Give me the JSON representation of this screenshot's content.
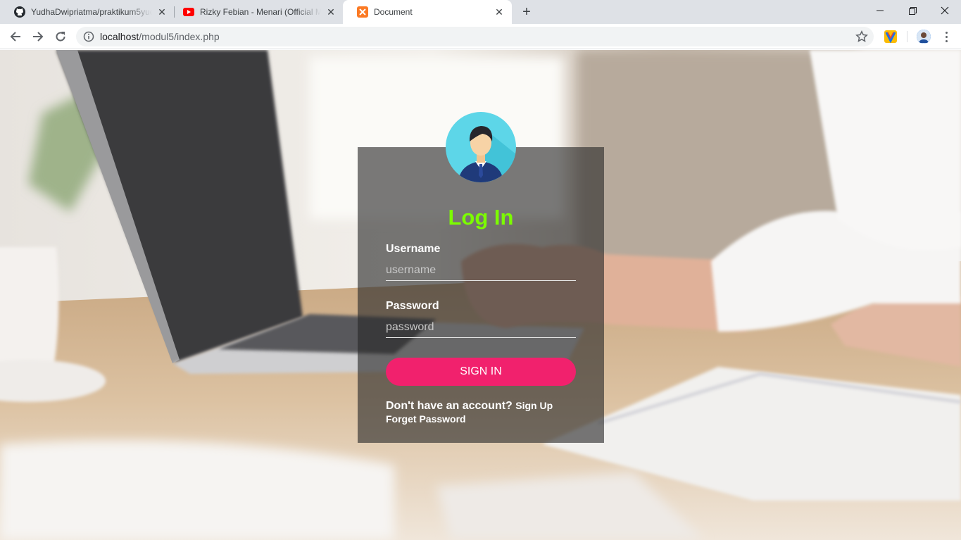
{
  "browser": {
    "tabs": [
      {
        "title": "YudhaDwipriatma/praktikum5yuc",
        "icon": "github-icon",
        "active": false
      },
      {
        "title": "Rizky Febian - Menari (Official M",
        "icon": "youtube-icon",
        "active": false
      },
      {
        "title": "Document",
        "icon": "xampp-icon",
        "active": true
      }
    ],
    "new_tab_symbol": "+",
    "url": {
      "host": "localhost",
      "path": "/modul5/index.php"
    }
  },
  "login": {
    "title": "Log In",
    "username_label": "Username",
    "username_placeholder": "username",
    "username_value": "",
    "password_label": "Password",
    "password_placeholder": "password",
    "password_value": "",
    "submit_label": "SIGN IN",
    "no_account_text": "Don't have an account?",
    "signup_link": "Sign Up",
    "forgot_link": "Forget Password"
  },
  "colors": {
    "title": "#7cfc00",
    "button": "#f1216d",
    "card": "rgba(40,40,40,0.62)",
    "tabstrip": "#dee1e6"
  }
}
